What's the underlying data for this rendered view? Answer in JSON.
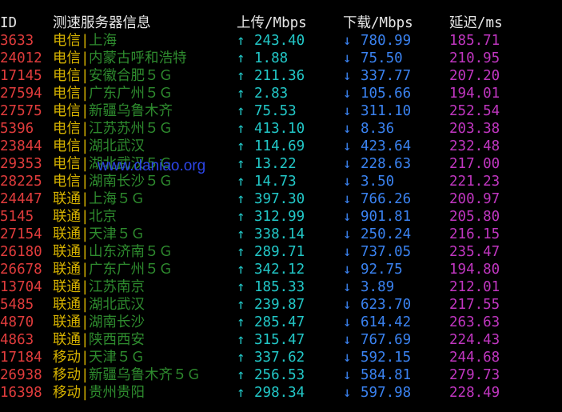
{
  "header": {
    "id": "ID",
    "server": "测速服务器信息",
    "upload": "上传/Mbps",
    "download": "下载/Mbps",
    "latency": "延迟/ms"
  },
  "colors": {
    "background": "#000000",
    "id": "#e03c3c",
    "isp": "#d7b300",
    "city": "#2e8b2e",
    "upload": "#22c7c7",
    "download": "#3a82f0",
    "latency": "#c036c0",
    "watermark": "#2c45e6"
  },
  "watermark": "www.daniao.org",
  "rows": [
    {
      "id": "3633",
      "isp": "电信",
      "city": "上海",
      "up": "243.40",
      "down": "780.99",
      "lat": "185.71"
    },
    {
      "id": "24012",
      "isp": "电信",
      "city": "内蒙古呼和浩特",
      "up": "1.88",
      "down": "75.50",
      "lat": "210.95"
    },
    {
      "id": "17145",
      "isp": "电信",
      "city": "安徽合肥５Ｇ",
      "up": "211.36",
      "down": "337.77",
      "lat": "207.20"
    },
    {
      "id": "27594",
      "isp": "电信",
      "city": "广东广州５Ｇ",
      "up": "2.83",
      "down": "105.66",
      "lat": "194.01"
    },
    {
      "id": "27575",
      "isp": "电信",
      "city": "新疆乌鲁木齐",
      "up": "75.53",
      "down": "311.10",
      "lat": "252.54"
    },
    {
      "id": "5396",
      "isp": "电信",
      "city": "江苏苏州５Ｇ",
      "up": "413.10",
      "down": "8.36",
      "lat": "203.38"
    },
    {
      "id": "23844",
      "isp": "电信",
      "city": "湖北武汉",
      "up": "114.69",
      "down": "423.64",
      "lat": "232.48"
    },
    {
      "id": "29353",
      "isp": "电信",
      "city": "湖北武汉５Ｇ",
      "up": "13.22",
      "down": "228.63",
      "lat": "217.00"
    },
    {
      "id": "28225",
      "isp": "电信",
      "city": "湖南长沙５Ｇ",
      "up": "14.73",
      "down": "3.50",
      "lat": "221.23"
    },
    {
      "id": "24447",
      "isp": "联通",
      "city": "上海５Ｇ",
      "up": "397.30",
      "down": "766.26",
      "lat": "200.97"
    },
    {
      "id": "5145",
      "isp": "联通",
      "city": "北京",
      "up": "312.99",
      "down": "901.81",
      "lat": "205.80"
    },
    {
      "id": "27154",
      "isp": "联通",
      "city": "天津５Ｇ",
      "up": "338.14",
      "down": "250.24",
      "lat": "216.15"
    },
    {
      "id": "26180",
      "isp": "联通",
      "city": "山东济南５Ｇ",
      "up": "289.71",
      "down": "737.05",
      "lat": "235.47"
    },
    {
      "id": "26678",
      "isp": "联通",
      "city": "广东广州５Ｇ",
      "up": "342.12",
      "down": "92.75",
      "lat": "194.80"
    },
    {
      "id": "13704",
      "isp": "联通",
      "city": "江苏南京",
      "up": "185.33",
      "down": "3.89",
      "lat": "212.01"
    },
    {
      "id": "5485",
      "isp": "联通",
      "city": "湖北武汉",
      "up": "239.87",
      "down": "623.70",
      "lat": "217.55"
    },
    {
      "id": "4870",
      "isp": "联通",
      "city": "湖南长沙",
      "up": "285.47",
      "down": "614.42",
      "lat": "263.63"
    },
    {
      "id": "4863",
      "isp": "联通",
      "city": "陕西西安",
      "up": "315.47",
      "down": "767.69",
      "lat": "224.43"
    },
    {
      "id": "17184",
      "isp": "移动",
      "city": "天津５Ｇ",
      "up": "337.62",
      "down": "592.15",
      "lat": "244.68"
    },
    {
      "id": "26938",
      "isp": "移动",
      "city": "新疆乌鲁木齐５Ｇ",
      "up": "256.53",
      "down": "584.81",
      "lat": "279.73"
    },
    {
      "id": "16398",
      "isp": "移动",
      "city": "贵州贵阳",
      "up": "298.34",
      "down": "597.98",
      "lat": "228.49"
    }
  ]
}
